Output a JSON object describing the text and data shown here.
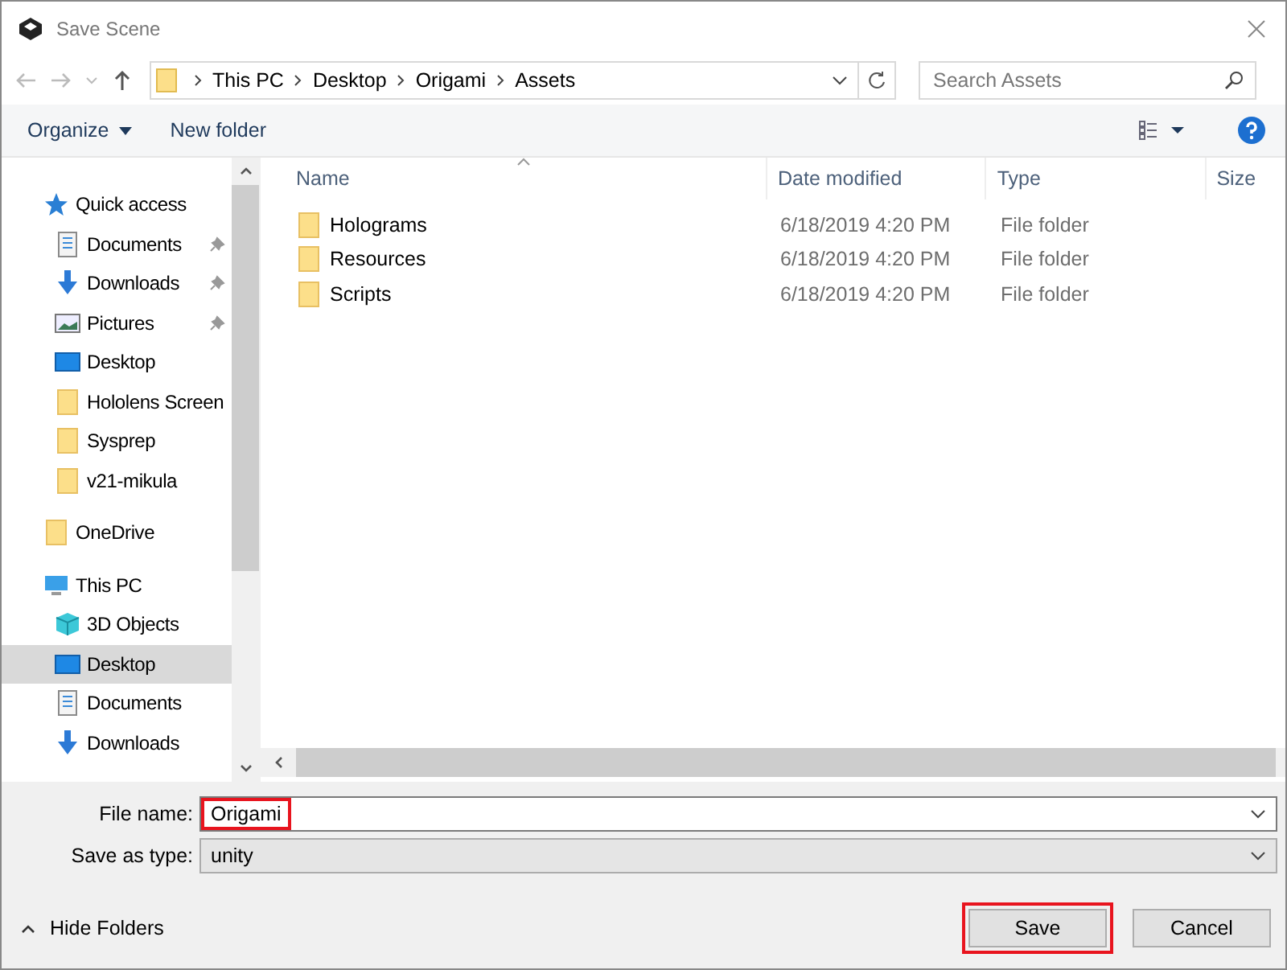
{
  "window": {
    "title": "Save Scene"
  },
  "address_bar": {
    "breadcrumbs": [
      "This PC",
      "Desktop",
      "Origami",
      "Assets"
    ]
  },
  "search": {
    "placeholder": "Search Assets"
  },
  "toolbar": {
    "organize": "Organize",
    "new_folder": "New folder"
  },
  "sidebar": {
    "groups": [
      {
        "label": "Quick access",
        "kind": "star",
        "selected": false,
        "children": [
          {
            "label": "Documents",
            "kind": "documents",
            "selected": false,
            "pinned": true
          },
          {
            "label": "Downloads",
            "kind": "downloads",
            "selected": false,
            "pinned": true
          },
          {
            "label": "Pictures",
            "kind": "pictures",
            "selected": false,
            "pinned": true
          },
          {
            "label": "Desktop",
            "kind": "desktop",
            "selected": false,
            "pinned": false
          },
          {
            "label": "Hololens Screen",
            "kind": "folder",
            "selected": false,
            "pinned": false
          },
          {
            "label": "Sysprep",
            "kind": "folder",
            "selected": false,
            "pinned": false
          },
          {
            "label": "v21-mikula",
            "kind": "folder",
            "selected": false,
            "pinned": false
          }
        ]
      },
      {
        "label": "OneDrive",
        "kind": "folder",
        "selected": false
      },
      {
        "label": "This PC",
        "kind": "pc",
        "selected": false,
        "children": [
          {
            "label": "3D Objects",
            "kind": "cube",
            "selected": false,
            "pinned": false
          },
          {
            "label": "Desktop",
            "kind": "desktop",
            "selected": true,
            "pinned": false
          },
          {
            "label": "Documents",
            "kind": "documents",
            "selected": false,
            "pinned": false
          },
          {
            "label": "Downloads",
            "kind": "downloads",
            "selected": false,
            "pinned": false
          }
        ]
      }
    ]
  },
  "table": {
    "columns": [
      "Name",
      "Date modified",
      "Type",
      "Size"
    ],
    "rows": [
      {
        "name": "Holograms",
        "date": "6/18/2019 4:20 PM",
        "type": "File folder"
      },
      {
        "name": "Resources",
        "date": "6/18/2019 4:20 PM",
        "type": "File folder"
      },
      {
        "name": "Scripts",
        "date": "6/18/2019 4:20 PM",
        "type": "File folder"
      }
    ]
  },
  "file_name": {
    "label": "File name:",
    "value": "Origami",
    "highlighted": true
  },
  "save_as_type": {
    "label": "Save as type:",
    "value": "unity"
  },
  "hide_folders": "Hide Folders",
  "buttons": [
    {
      "label": "Save",
      "highlighted": true
    },
    {
      "label": "Cancel",
      "highlighted": false
    }
  ]
}
